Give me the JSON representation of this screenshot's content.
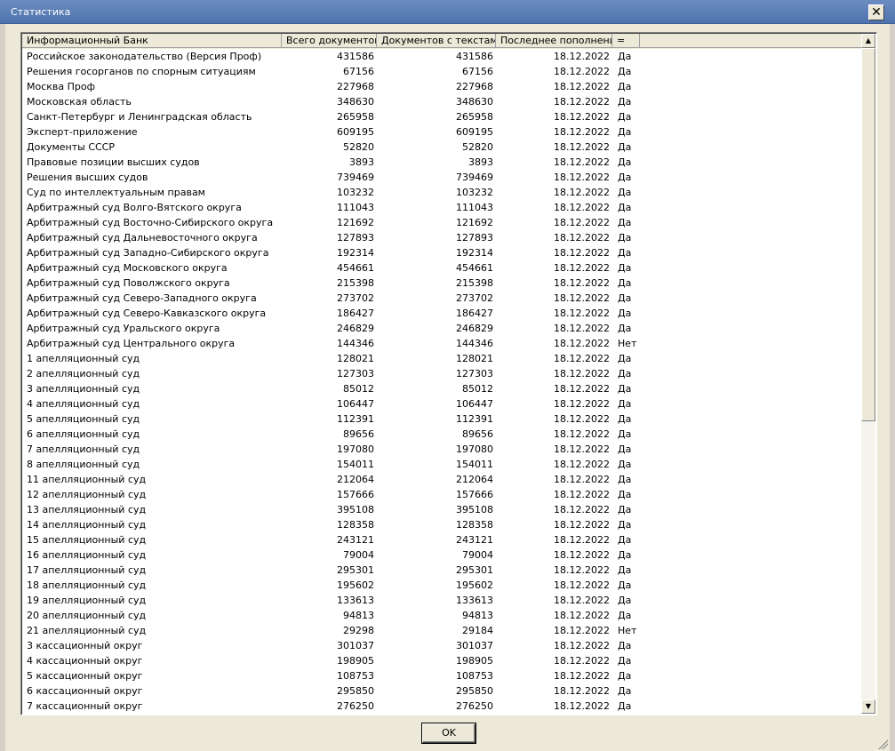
{
  "window": {
    "title": "Статистика"
  },
  "columns": [
    "Информационный Банк",
    "Всего документов",
    "Документов с текстами",
    "Последнее пополнение",
    "="
  ],
  "rows": [
    [
      "Российское законодательство (Версия Проф)",
      "431586",
      "431586",
      "18.12.2022",
      "Да"
    ],
    [
      "Решения госорганов по спорным ситуациям",
      "67156",
      "67156",
      "18.12.2022",
      "Да"
    ],
    [
      "Москва Проф",
      "227968",
      "227968",
      "18.12.2022",
      "Да"
    ],
    [
      "Московская область",
      "348630",
      "348630",
      "18.12.2022",
      "Да"
    ],
    [
      "Санкт-Петербург и Ленинградская область",
      "265958",
      "265958",
      "18.12.2022",
      "Да"
    ],
    [
      "Эксперт-приложение",
      "609195",
      "609195",
      "18.12.2022",
      "Да"
    ],
    [
      "Документы СССР",
      "52820",
      "52820",
      "18.12.2022",
      "Да"
    ],
    [
      "Правовые позиции высших судов",
      "3893",
      "3893",
      "18.12.2022",
      "Да"
    ],
    [
      "Решения высших судов",
      "739469",
      "739469",
      "18.12.2022",
      "Да"
    ],
    [
      "Суд по интеллектуальным правам",
      "103232",
      "103232",
      "18.12.2022",
      "Да"
    ],
    [
      "Арбитражный суд Волго-Вятского округа",
      "111043",
      "111043",
      "18.12.2022",
      "Да"
    ],
    [
      "Арбитражный суд Восточно-Сибирского округа",
      "121692",
      "121692",
      "18.12.2022",
      "Да"
    ],
    [
      "Арбитражный суд Дальневосточного округа",
      "127893",
      "127893",
      "18.12.2022",
      "Да"
    ],
    [
      "Арбитражный суд Западно-Сибирского округа",
      "192314",
      "192314",
      "18.12.2022",
      "Да"
    ],
    [
      "Арбитражный суд Московского округа",
      "454661",
      "454661",
      "18.12.2022",
      "Да"
    ],
    [
      "Арбитражный суд Поволжского округа",
      "215398",
      "215398",
      "18.12.2022",
      "Да"
    ],
    [
      "Арбитражный суд Северо-Западного округа",
      "273702",
      "273702",
      "18.12.2022",
      "Да"
    ],
    [
      "Арбитражный суд Северо-Кавказского округа",
      "186427",
      "186427",
      "18.12.2022",
      "Да"
    ],
    [
      "Арбитражный суд Уральского округа",
      "246829",
      "246829",
      "18.12.2022",
      "Да"
    ],
    [
      "Арбитражный суд Центрального округа",
      "144346",
      "144346",
      "18.12.2022",
      "Нет"
    ],
    [
      "1 апелляционный суд",
      "128021",
      "128021",
      "18.12.2022",
      "Да"
    ],
    [
      "2 апелляционный суд",
      "127303",
      "127303",
      "18.12.2022",
      "Да"
    ],
    [
      "3 апелляционный суд",
      "85012",
      "85012",
      "18.12.2022",
      "Да"
    ],
    [
      "4 апелляционный суд",
      "106447",
      "106447",
      "18.12.2022",
      "Да"
    ],
    [
      "5 апелляционный суд",
      "112391",
      "112391",
      "18.12.2022",
      "Да"
    ],
    [
      "6 апелляционный суд",
      "89656",
      "89656",
      "18.12.2022",
      "Да"
    ],
    [
      "7 апелляционный суд",
      "197080",
      "197080",
      "18.12.2022",
      "Да"
    ],
    [
      "8 апелляционный суд",
      "154011",
      "154011",
      "18.12.2022",
      "Да"
    ],
    [
      "11 апелляционный суд",
      "212064",
      "212064",
      "18.12.2022",
      "Да"
    ],
    [
      "12 апелляционный суд",
      "157666",
      "157666",
      "18.12.2022",
      "Да"
    ],
    [
      "13 апелляционный суд",
      "395108",
      "395108",
      "18.12.2022",
      "Да"
    ],
    [
      "14 апелляционный суд",
      "128358",
      "128358",
      "18.12.2022",
      "Да"
    ],
    [
      "15 апелляционный суд",
      "243121",
      "243121",
      "18.12.2022",
      "Да"
    ],
    [
      "16 апелляционный суд",
      "79004",
      "79004",
      "18.12.2022",
      "Да"
    ],
    [
      "17 апелляционный суд",
      "295301",
      "295301",
      "18.12.2022",
      "Да"
    ],
    [
      "18 апелляционный суд",
      "195602",
      "195602",
      "18.12.2022",
      "Да"
    ],
    [
      "19 апелляционный суд",
      "133613",
      "133613",
      "18.12.2022",
      "Да"
    ],
    [
      "20 апелляционный суд",
      "94813",
      "94813",
      "18.12.2022",
      "Да"
    ],
    [
      "21 апелляционный суд",
      "29298",
      "29184",
      "18.12.2022",
      "Нет"
    ],
    [
      "3 кассационный округ",
      "301037",
      "301037",
      "18.12.2022",
      "Да"
    ],
    [
      "4 кассационный округ",
      "198905",
      "198905",
      "18.12.2022",
      "Да"
    ],
    [
      "5 кассационный округ",
      "108753",
      "108753",
      "18.12.2022",
      "Да"
    ],
    [
      "6 кассационный округ",
      "295850",
      "295850",
      "18.12.2022",
      "Да"
    ],
    [
      "7 кассационный округ",
      "276250",
      "276250",
      "18.12.2022",
      "Да"
    ]
  ],
  "ok_button": "OK",
  "icons": {
    "close": "close-icon",
    "scroll_up": "scroll-up-arrow-icon",
    "scroll_down": "scroll-down-arrow-icon",
    "resize": "resize-grip-icon"
  }
}
